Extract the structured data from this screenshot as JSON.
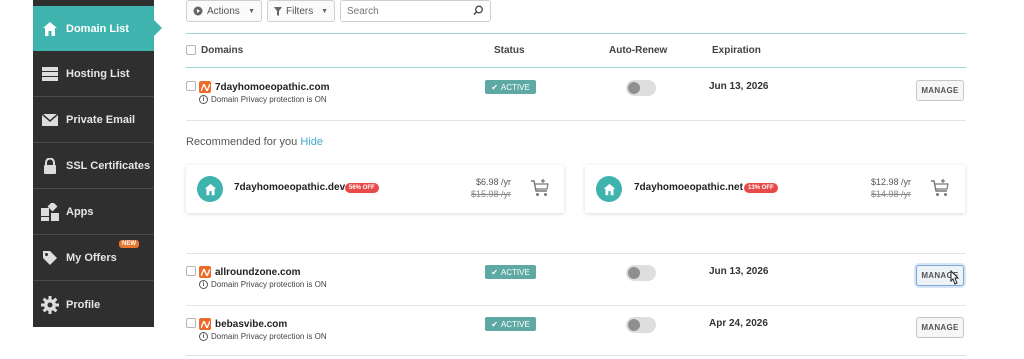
{
  "sidebar": {
    "items": [
      {
        "label": "Domain List",
        "icon": "house-icon",
        "active": true
      },
      {
        "label": "Hosting List",
        "icon": "server-icon"
      },
      {
        "label": "Private Email",
        "icon": "envelope-icon"
      },
      {
        "label": "SSL Certificates",
        "icon": "lock-icon"
      },
      {
        "label": "Apps",
        "icon": "apps-icon"
      },
      {
        "label": "My Offers",
        "icon": "tag-icon",
        "badge": "NEW"
      },
      {
        "label": "Profile",
        "icon": "gear-icon"
      }
    ]
  },
  "toolbar": {
    "actions_label": "Actions",
    "filters_label": "Filters",
    "search_placeholder": "Search"
  },
  "table": {
    "headers": {
      "domains": "Domains",
      "status": "Status",
      "auto_renew": "Auto-Renew",
      "expiration": "Expiration"
    },
    "rows": [
      {
        "domain": "7dayhomoeopathic.com",
        "privacy": "Domain Privacy protection is ON",
        "status": "ACTIVE",
        "expiration": "Jun 13, 2026",
        "manage": "MANAGE"
      },
      {
        "domain": "allroundzone.com",
        "privacy": "Domain Privacy protection is ON",
        "status": "ACTIVE",
        "expiration": "Jun 13, 2026",
        "manage": "MANAGE"
      },
      {
        "domain": "bebasvibe.com",
        "privacy": "Domain Privacy protection is ON",
        "status": "ACTIVE",
        "expiration": "Apr 24, 2026",
        "manage": "MANAGE"
      }
    ]
  },
  "recommendations": {
    "title": "Recommended for you",
    "hide_label": "Hide",
    "cards": [
      {
        "domain": "7dayhomoeopathic.dev",
        "discount": "56% OFF",
        "price": "$6.98 /yr",
        "old_price": "$15.98 /yr"
      },
      {
        "domain": "7dayhomoeopathic.net",
        "discount": "13% OFF",
        "price": "$12.98 /yr",
        "old_price": "$14.98 /yr"
      }
    ]
  },
  "colors": {
    "accent": "#3fb3ad",
    "sidebar": "#2f2f2f",
    "status": "#5fa9a4",
    "discount": "#e84a4a",
    "new_badge": "#e8762d"
  }
}
